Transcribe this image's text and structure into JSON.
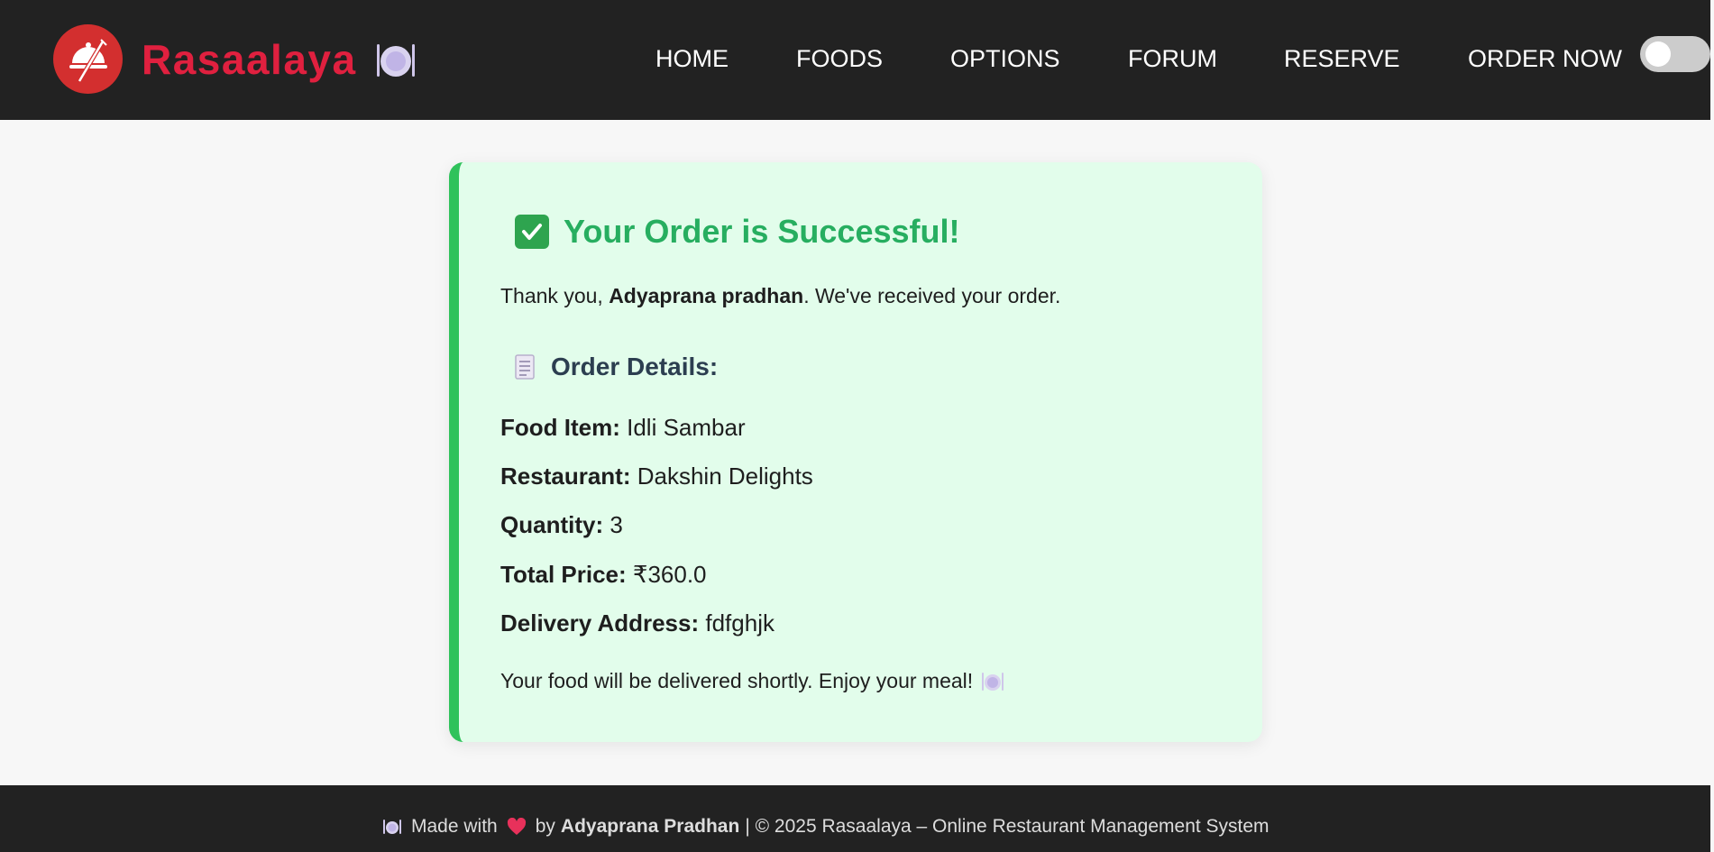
{
  "brand": {
    "name": "Rasaalaya"
  },
  "nav": {
    "home": "HOME",
    "foods": "FOODS",
    "options": "OPTIONS",
    "forum": "FORUM",
    "reserve": "RESERVE",
    "order_now": "ORDER NOW"
  },
  "theme_toggle": {
    "state": "off"
  },
  "order": {
    "title": "Your Order is Successful!",
    "thanks_prefix": "Thank you, ",
    "customer_name": "Adyaprana pradhan",
    "thanks_suffix": ". We've received your order.",
    "details_heading": "Order Details:",
    "food_item_label": "Food Item:",
    "food_item_value": "Idli Sambar",
    "restaurant_label": "Restaurant:",
    "restaurant_value": "Dakshin Delights",
    "quantity_label": "Quantity:",
    "quantity_value": "3",
    "total_label": "Total Price:",
    "total_value": "₹360.0",
    "address_label": "Delivery Address:",
    "address_value": "fdfghjk",
    "closing": "Your food will be delivered shortly. Enjoy your meal!"
  },
  "footer": {
    "made_with": "Made with",
    "by": "by",
    "author": "Adyaprana Pradhan",
    "rest": "| © 2025 Rasaalaya – Online Restaurant Management System"
  },
  "colors": {
    "navbar": "#222222",
    "brand_red": "#e0203f",
    "success_green": "#27ae60",
    "card_bg": "#e2fdeb"
  },
  "icons": {
    "logo": "cloche-fork-knife-icon",
    "plate": "plate-cutlery-icon",
    "check": "check-mark-button-icon",
    "receipt": "receipt-icon",
    "heart": "heart-icon"
  }
}
